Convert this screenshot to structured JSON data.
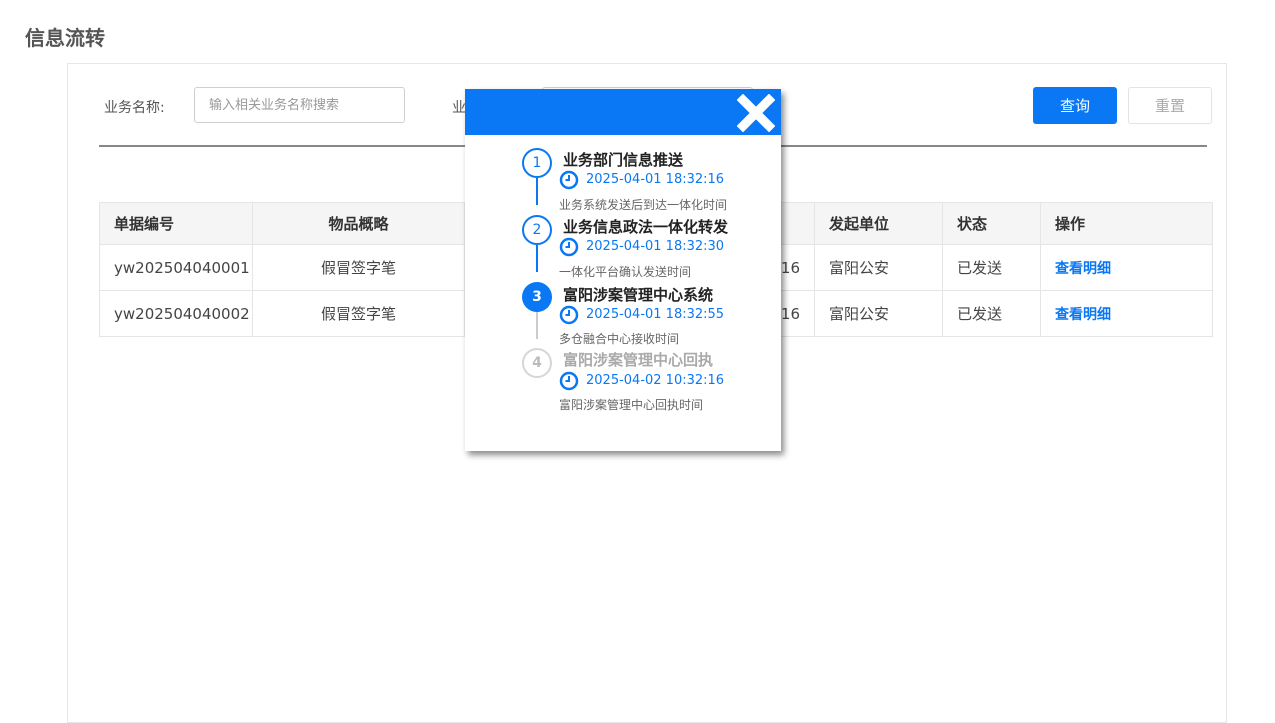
{
  "page": {
    "title": "信息流转"
  },
  "search": {
    "name_label": "业务名称:",
    "name_placeholder": "输入相关业务名称搜索",
    "second_label_partial": "业",
    "query_button": "查询",
    "reset_button": "重置"
  },
  "table": {
    "headers": [
      "单据编号",
      "物品概略",
      "",
      "发起单位",
      "状态",
      "操作"
    ],
    "rows": [
      {
        "id": "yw202504040001",
        "summary": "假冒签字笔",
        "time_partial": ":16",
        "unit": "富阳公安",
        "status": "已发送",
        "action": "查看明细"
      },
      {
        "id": "yw202504040002",
        "summary": "假冒签字笔",
        "time_partial": ":16",
        "unit": "富阳公安",
        "status": "已发送",
        "action": "查看明细"
      }
    ]
  },
  "modal": {
    "close_icon": "close-icon",
    "steps": [
      {
        "number": "1",
        "title": "业务部门信息推送",
        "time": "2025-04-01 18:32:16",
        "desc": "业务系统发送后到达一体化时间",
        "state": "done"
      },
      {
        "number": "2",
        "title": "业务信息政法一体化转发",
        "time": "2025-04-01 18:32:30",
        "desc": "一体化平台确认发送时间",
        "state": "done"
      },
      {
        "number": "3",
        "title": "富阳涉案管理中心系统",
        "time": "2025-04-01 18:32:55",
        "desc": "多仓融合中心接收时间",
        "state": "current"
      },
      {
        "number": "4",
        "title": "富阳涉案管理中心回执",
        "time": "2025-04-02 10:32:16",
        "desc": "富阳涉案管理中心回执时间",
        "state": "pending"
      }
    ]
  },
  "colors": {
    "primary": "#0a78f5",
    "pending": "#cccccc"
  }
}
